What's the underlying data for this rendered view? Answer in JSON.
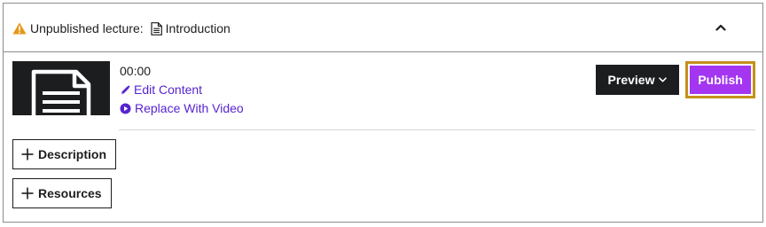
{
  "header": {
    "status_label": "Unpublished lecture:",
    "lecture_title": "Introduction",
    "warning_color": "#e59819"
  },
  "lecture": {
    "duration": "00:00",
    "edit_content_label": "Edit Content",
    "replace_video_label": "Replace With Video",
    "link_color": "#5624d0"
  },
  "actions": {
    "preview_label": "Preview",
    "publish_label": "Publish",
    "publish_color": "#a435f0",
    "focus_ring_color": "#c4901b"
  },
  "extras": {
    "description_label": "Description",
    "resources_label": "Resources"
  }
}
